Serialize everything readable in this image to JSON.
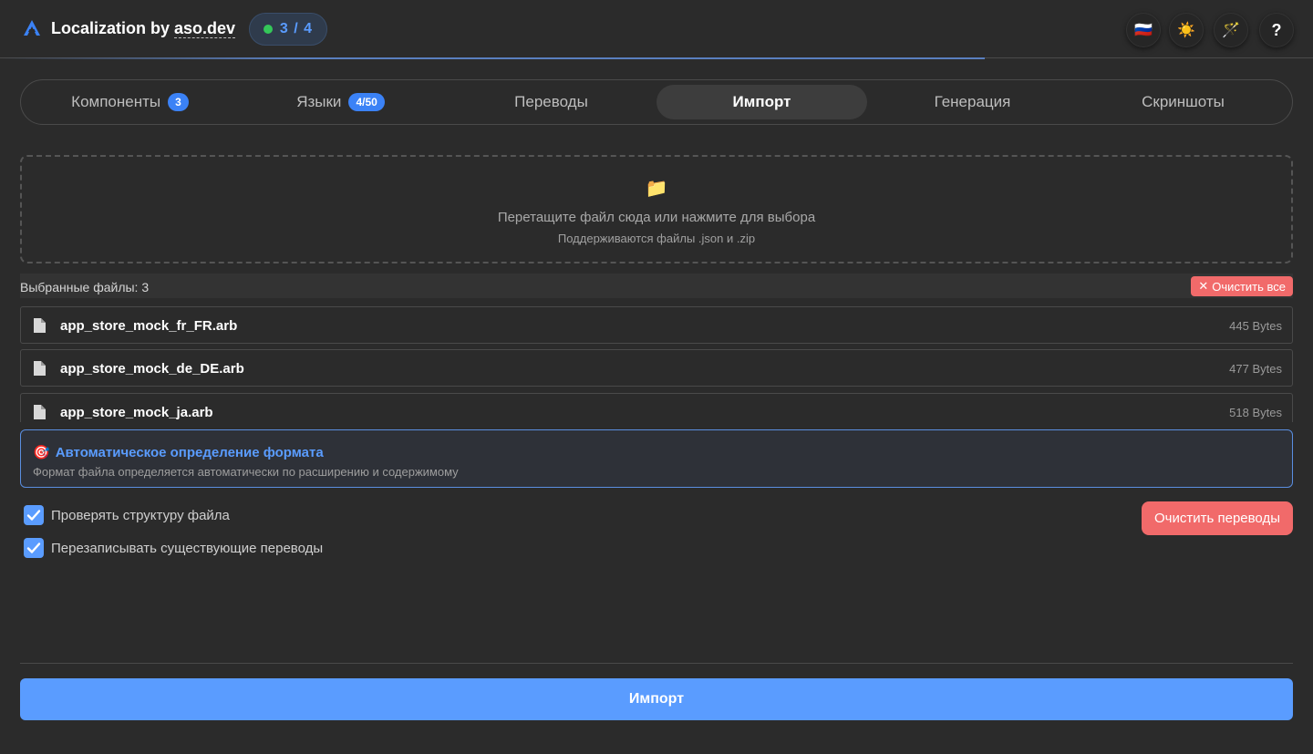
{
  "header": {
    "title_prefix": "Localization by ",
    "title_brand": "aso.dev",
    "progress": "3 / 4",
    "progress_fraction": 0.75,
    "buttons": [
      {
        "name": "language-flag-ru",
        "glyph": "🇷🇺"
      },
      {
        "name": "theme-toggle",
        "glyph": "☀️"
      },
      {
        "name": "magic-wand",
        "glyph": "🪄"
      },
      {
        "name": "help",
        "glyph": "?"
      }
    ]
  },
  "tabs": [
    {
      "label": "Компоненты",
      "badge": "3",
      "active": false
    },
    {
      "label": "Языки",
      "badge": "4/50",
      "active": false
    },
    {
      "label": "Переводы",
      "badge": "",
      "active": false
    },
    {
      "label": "Импорт",
      "badge": "",
      "active": true
    },
    {
      "label": "Генерация",
      "badge": "",
      "active": false
    },
    {
      "label": "Скриншоты",
      "badge": "",
      "active": false
    }
  ],
  "dropzone": {
    "icon": "📁",
    "main_text": "Перетащите файл сюда или нажмите для выбора",
    "sub_text": "Поддерживаются файлы .json и .zip"
  },
  "files": {
    "header_label": "Выбранные файлы: 3",
    "clear_all_label": "Очистить все",
    "items": [
      {
        "name": "app_store_mock_fr_FR.arb",
        "size": "445 Bytes"
      },
      {
        "name": "app_store_mock_de_DE.arb",
        "size": "477 Bytes"
      },
      {
        "name": "app_store_mock_ja.arb",
        "size": "518 Bytes"
      }
    ]
  },
  "auto_detect": {
    "icon": "🎯",
    "title": "Автоматическое определение формата",
    "description": "Формат файла определяется автоматически по расширению и содержимому"
  },
  "options": {
    "validate_structure": {
      "label": "Проверять структуру файла",
      "checked": true
    },
    "overwrite_existing": {
      "label": "Перезаписывать существующие переводы",
      "checked": true
    }
  },
  "clear_translations_label": "Очистить переводы",
  "import_label": "Импорт",
  "colors": {
    "accent": "#5a9cff",
    "danger": "#f16a6a",
    "success": "#34c759",
    "background": "#2b2b2b"
  }
}
